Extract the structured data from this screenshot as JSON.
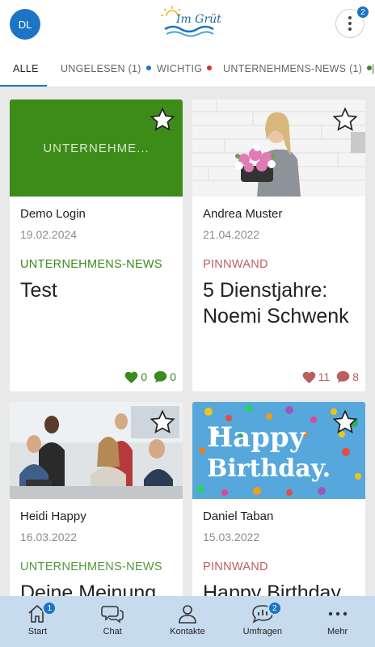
{
  "header": {
    "avatar_initials": "DL",
    "logo_text": "Im Grüt",
    "more_badge": "2"
  },
  "tabs": [
    {
      "label": "ALLE",
      "active": true
    },
    {
      "label": "UNGELESEN (1)",
      "dot_color": "#1b74c5"
    },
    {
      "label": "WICHTIG",
      "dot_color": "#d0302f"
    },
    {
      "label": "UNTERNEHMENS-NEWS (1)",
      "dot_color": "#3a8a1f"
    }
  ],
  "colors": {
    "accent": "#1b74c5",
    "news": "#3a8a1f",
    "news_light": "#4f9a3a",
    "pinnwand": "#b95f5f"
  },
  "cards": [
    {
      "image_text": "UNTERNEHME...",
      "author": "Demo Login",
      "date": "19.02.2024",
      "category": "UNTERNEHMENS-NEWS",
      "title": "Test",
      "likes": "0",
      "comments": "0"
    },
    {
      "author": "Andrea Muster",
      "date": "21.04.2022",
      "category": "PINNWAND",
      "title": "5 Dienstjahre: Noemi Schwenk",
      "likes": "11",
      "comments": "8"
    },
    {
      "author": "Heidi Happy",
      "date": "16.03.2022",
      "category": "UNTERNEHMENS-NEWS",
      "title": "Deine Meinung"
    },
    {
      "image_text_1": "Happy",
      "image_text_2": "Birthday.",
      "author": "Daniel Taban",
      "date": "15.03.2022",
      "category": "PINNWAND",
      "title": "Happy Birthday"
    }
  ],
  "bottom_nav": [
    {
      "label": "Start",
      "icon": "home-icon",
      "badge": "1"
    },
    {
      "label": "Chat",
      "icon": "chat-icon"
    },
    {
      "label": "Kontakte",
      "icon": "person-icon"
    },
    {
      "label": "Umfragen",
      "icon": "poll-icon",
      "badge": "2"
    },
    {
      "label": "Mehr",
      "icon": "dots-icon"
    }
  ]
}
